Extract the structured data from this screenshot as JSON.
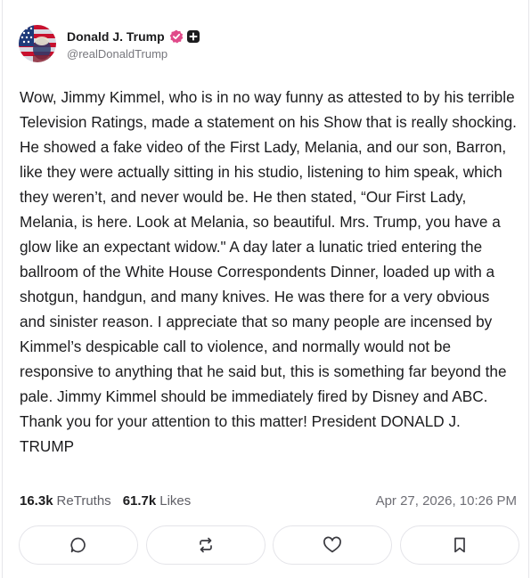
{
  "author": {
    "display_name": "Donald J. Trump",
    "handle": "@realDonaldTrump",
    "avatar_icon": "flag-portrait-avatar",
    "verified_icon": "verified-badge-icon",
    "verified_color": "#e04a8a",
    "plus_icon": "plus-badge-icon"
  },
  "post": {
    "text": "Wow, Jimmy Kimmel, who is in no way funny as attested to by his terrible Television Ratings, made a statement on his Show that is really shocking. He showed a fake video of the First Lady, Melania, and our son, Barron, like they were actually sitting in his studio, listening to him speak, which they weren’t, and never would be. He then stated, “Our First Lady, Melania, is here. Look at Melania, so beautiful. Mrs. Trump, you have a glow like an expectant widow.\" A day later a lunatic tried entering the ballroom of the White House Correspondents Dinner, loaded up with a shotgun, handgun, and many knives. He was there for a very obvious and sinister reason. I appreciate that so many people are incensed by Kimmel’s despicable call to violence, and normally would not be responsive to anything that he said but, this is something far beyond the pale. Jimmy Kimmel should be immediately fired by Disney and ABC. Thank you for your attention to this matter! President DONALD J. TRUMP"
  },
  "stats": {
    "retruths_count": "16.3k",
    "retruths_label": "ReTruths",
    "likes_count": "61.7k",
    "likes_label": "Likes",
    "timestamp": "Apr 27, 2026, 10:26 PM"
  },
  "actions": [
    {
      "icon": "reply-icon"
    },
    {
      "icon": "retruth-icon"
    },
    {
      "icon": "like-heart-icon"
    },
    {
      "icon": "bookmark-icon"
    }
  ]
}
